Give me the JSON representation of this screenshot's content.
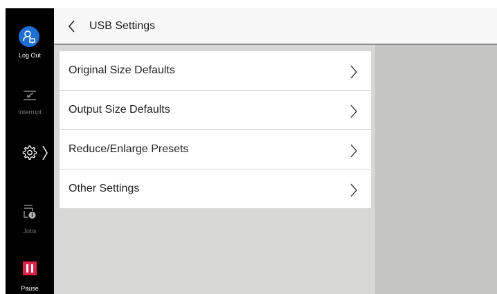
{
  "sidebar": {
    "logout_label": "Log Out",
    "interrupt_label": "Interrupt",
    "jobs_label": "Jobs",
    "pause_label": "Pause",
    "icons": [
      "logout-icon",
      "interrupt-icon",
      "gear-icon",
      "chevron-right-icon",
      "jobs-icon",
      "pause-icon"
    ]
  },
  "header": {
    "title": "USB Settings",
    "back_icon": "chevron-left-icon"
  },
  "menu": {
    "items": [
      {
        "label": "Original Size Defaults"
      },
      {
        "label": "Output Size Defaults"
      },
      {
        "label": "Reduce/Enlarge Presets"
      },
      {
        "label": "Other Settings"
      }
    ]
  },
  "colors": {
    "sidebar_bg": "#000000",
    "logout_accent": "#1d6fd3",
    "pause_accent": "#e0224b",
    "content_bg": "#d7d7d5",
    "right_panel_bg": "#c5c5c3",
    "header_bg": "#f7f7f7"
  }
}
